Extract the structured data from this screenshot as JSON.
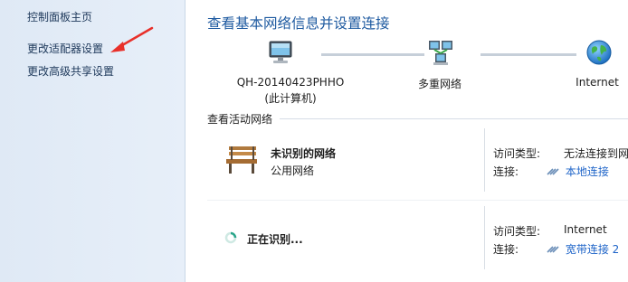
{
  "sidebar": {
    "items": [
      {
        "label": "控制面板主页"
      },
      {
        "label": "更改适配器设置"
      },
      {
        "label": "更改高级共享设置"
      }
    ]
  },
  "main": {
    "title": "查看基本网络信息并设置连接",
    "map": {
      "computer": {
        "name": "QH-20140423PHHO",
        "sub": "(此计算机)",
        "icon": "computer-icon"
      },
      "network": {
        "name": "多重网络",
        "icon": "network-icon"
      },
      "internet": {
        "name": "Internet",
        "icon": "globe-icon"
      }
    },
    "active_section_title": "查看活动网络",
    "networks": [
      {
        "name": "未识别的网络",
        "type": "公用网络",
        "icon": "bench-icon",
        "access_label": "访问类型:",
        "access_value": "无法连接到网",
        "connection_label": "连接:",
        "connection_value": "本地连接"
      },
      {
        "name": "正在识别...",
        "type": "",
        "icon": "spinner-icon",
        "access_label": "访问类型:",
        "access_value": "Internet",
        "connection_label": "连接:",
        "connection_value": "宽带连接 2"
      }
    ]
  },
  "colors": {
    "title": "#1e5aa0",
    "link": "#1e64c8",
    "sidebar_bg": "#e3ecf7",
    "annotation_arrow": "#e8302a"
  }
}
